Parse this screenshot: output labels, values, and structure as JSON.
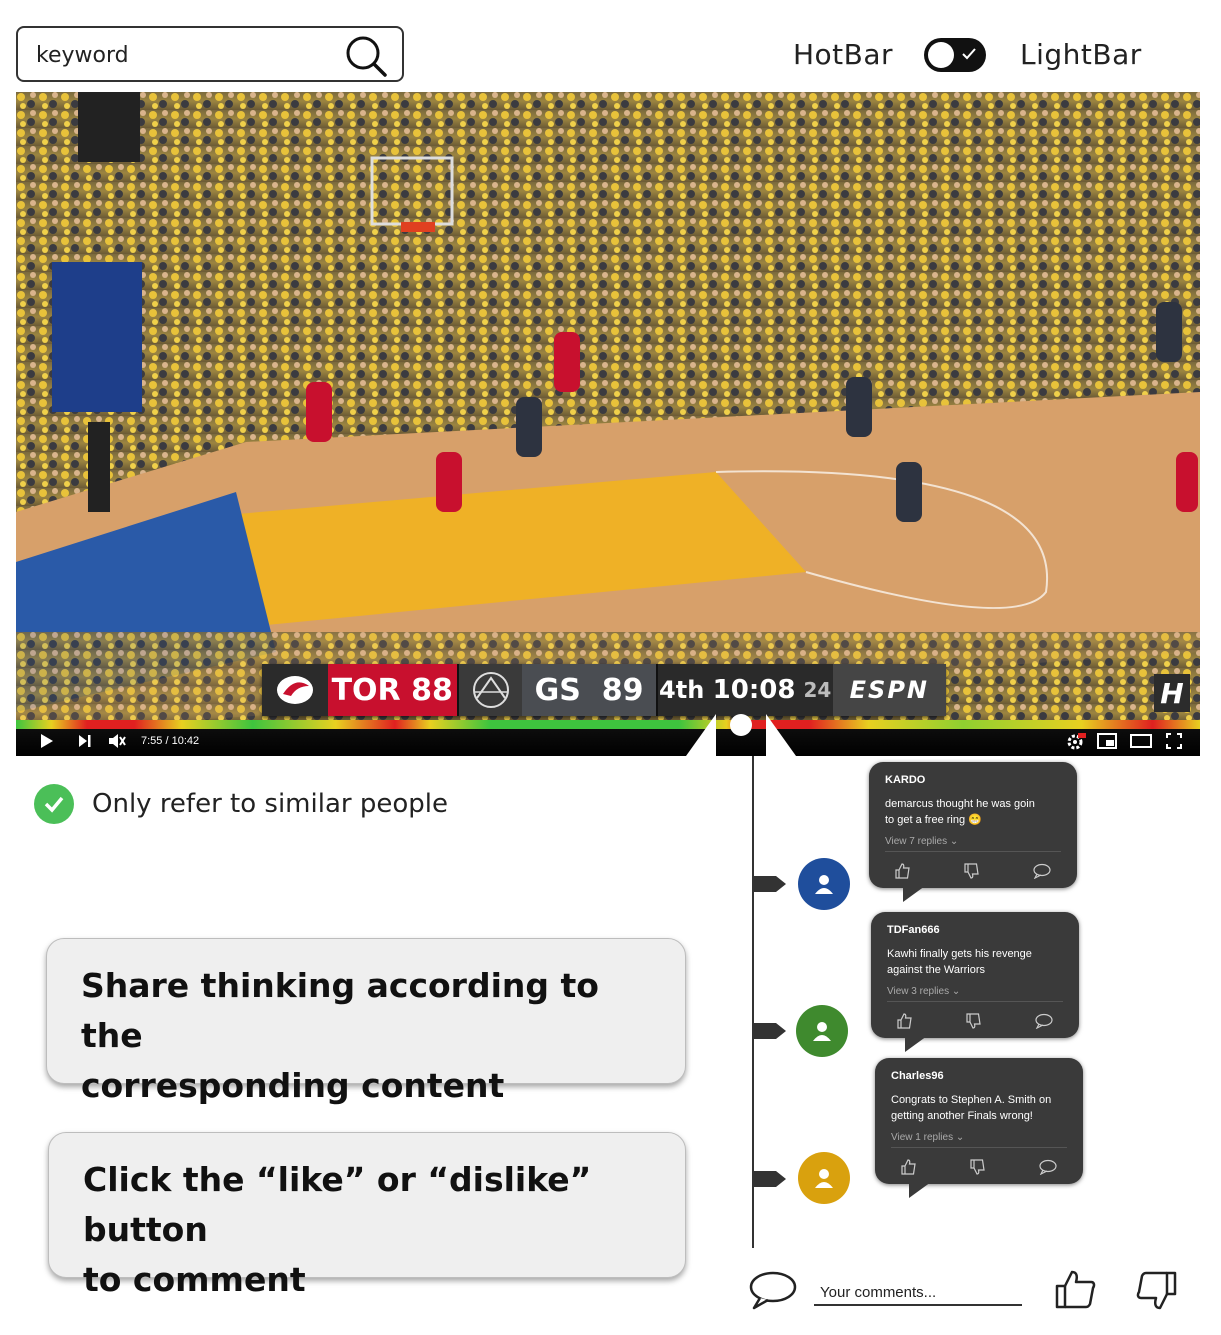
{
  "search": {
    "value": "keyword"
  },
  "mode": {
    "left_label": "HotBar",
    "right_label": "LightBar",
    "toggle_on": true
  },
  "video": {
    "scorebug": {
      "team1": "TOR",
      "score1": "88",
      "team2": "GS",
      "score2": "89",
      "period": "4th",
      "clock": "10:08",
      "shot_clock": "24",
      "network": "ESPN"
    },
    "channel_logo": "H",
    "time_display": "7:55 / 10:42",
    "progress": 0.742,
    "colors": {
      "team1": "#c8102e",
      "team2": "#4a4d52"
    }
  },
  "filter": {
    "label": "Only refer to similar people",
    "checked": true
  },
  "callouts": [
    {
      "line1": "Share thinking  according to the",
      "line2": "corresponding content"
    },
    {
      "line1": "Click the “like” or “dislike” button",
      "line2": "to comment"
    }
  ],
  "comments": [
    {
      "author": "KARDO",
      "line1": "demarcus thought he was goin",
      "line2": "to get a free ring 😁",
      "replies": "View 7 replies",
      "avatar_color": "#1f4e9c"
    },
    {
      "author": "TDFan666",
      "line1": "Kawhi finally gets his revenge",
      "line2": "against the Warriors",
      "replies": "View 3 replies",
      "avatar_color": "#3f8a2e"
    },
    {
      "author": "Charles96",
      "line1": "Congrats to Stephen A. Smith on",
      "line2": "getting another Finals wrong!",
      "replies": "View 1 replies",
      "avatar_color": "#d9a10e"
    }
  ],
  "comment_input": {
    "placeholder": "Your comments..."
  }
}
